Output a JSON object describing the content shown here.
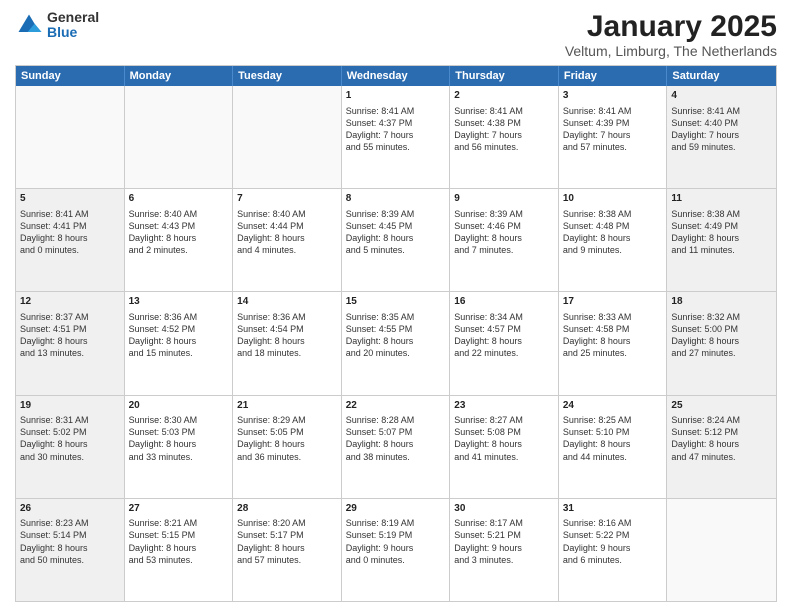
{
  "logo": {
    "general": "General",
    "blue": "Blue"
  },
  "header": {
    "month": "January 2025",
    "location": "Veltum, Limburg, The Netherlands"
  },
  "days": [
    "Sunday",
    "Monday",
    "Tuesday",
    "Wednesday",
    "Thursday",
    "Friday",
    "Saturday"
  ],
  "weeks": [
    [
      {
        "num": "",
        "text": "",
        "empty": true
      },
      {
        "num": "",
        "text": "",
        "empty": true
      },
      {
        "num": "",
        "text": "",
        "empty": true
      },
      {
        "num": "1",
        "text": "Sunrise: 8:41 AM\nSunset: 4:37 PM\nDaylight: 7 hours\nand 55 minutes."
      },
      {
        "num": "2",
        "text": "Sunrise: 8:41 AM\nSunset: 4:38 PM\nDaylight: 7 hours\nand 56 minutes."
      },
      {
        "num": "3",
        "text": "Sunrise: 8:41 AM\nSunset: 4:39 PM\nDaylight: 7 hours\nand 57 minutes."
      },
      {
        "num": "4",
        "text": "Sunrise: 8:41 AM\nSunset: 4:40 PM\nDaylight: 7 hours\nand 59 minutes."
      }
    ],
    [
      {
        "num": "5",
        "text": "Sunrise: 8:41 AM\nSunset: 4:41 PM\nDaylight: 8 hours\nand 0 minutes."
      },
      {
        "num": "6",
        "text": "Sunrise: 8:40 AM\nSunset: 4:43 PM\nDaylight: 8 hours\nand 2 minutes."
      },
      {
        "num": "7",
        "text": "Sunrise: 8:40 AM\nSunset: 4:44 PM\nDaylight: 8 hours\nand 4 minutes."
      },
      {
        "num": "8",
        "text": "Sunrise: 8:39 AM\nSunset: 4:45 PM\nDaylight: 8 hours\nand 5 minutes."
      },
      {
        "num": "9",
        "text": "Sunrise: 8:39 AM\nSunset: 4:46 PM\nDaylight: 8 hours\nand 7 minutes."
      },
      {
        "num": "10",
        "text": "Sunrise: 8:38 AM\nSunset: 4:48 PM\nDaylight: 8 hours\nand 9 minutes."
      },
      {
        "num": "11",
        "text": "Sunrise: 8:38 AM\nSunset: 4:49 PM\nDaylight: 8 hours\nand 11 minutes."
      }
    ],
    [
      {
        "num": "12",
        "text": "Sunrise: 8:37 AM\nSunset: 4:51 PM\nDaylight: 8 hours\nand 13 minutes."
      },
      {
        "num": "13",
        "text": "Sunrise: 8:36 AM\nSunset: 4:52 PM\nDaylight: 8 hours\nand 15 minutes."
      },
      {
        "num": "14",
        "text": "Sunrise: 8:36 AM\nSunset: 4:54 PM\nDaylight: 8 hours\nand 18 minutes."
      },
      {
        "num": "15",
        "text": "Sunrise: 8:35 AM\nSunset: 4:55 PM\nDaylight: 8 hours\nand 20 minutes."
      },
      {
        "num": "16",
        "text": "Sunrise: 8:34 AM\nSunset: 4:57 PM\nDaylight: 8 hours\nand 22 minutes."
      },
      {
        "num": "17",
        "text": "Sunrise: 8:33 AM\nSunset: 4:58 PM\nDaylight: 8 hours\nand 25 minutes."
      },
      {
        "num": "18",
        "text": "Sunrise: 8:32 AM\nSunset: 5:00 PM\nDaylight: 8 hours\nand 27 minutes."
      }
    ],
    [
      {
        "num": "19",
        "text": "Sunrise: 8:31 AM\nSunset: 5:02 PM\nDaylight: 8 hours\nand 30 minutes."
      },
      {
        "num": "20",
        "text": "Sunrise: 8:30 AM\nSunset: 5:03 PM\nDaylight: 8 hours\nand 33 minutes."
      },
      {
        "num": "21",
        "text": "Sunrise: 8:29 AM\nSunset: 5:05 PM\nDaylight: 8 hours\nand 36 minutes."
      },
      {
        "num": "22",
        "text": "Sunrise: 8:28 AM\nSunset: 5:07 PM\nDaylight: 8 hours\nand 38 minutes."
      },
      {
        "num": "23",
        "text": "Sunrise: 8:27 AM\nSunset: 5:08 PM\nDaylight: 8 hours\nand 41 minutes."
      },
      {
        "num": "24",
        "text": "Sunrise: 8:25 AM\nSunset: 5:10 PM\nDaylight: 8 hours\nand 44 minutes."
      },
      {
        "num": "25",
        "text": "Sunrise: 8:24 AM\nSunset: 5:12 PM\nDaylight: 8 hours\nand 47 minutes."
      }
    ],
    [
      {
        "num": "26",
        "text": "Sunrise: 8:23 AM\nSunset: 5:14 PM\nDaylight: 8 hours\nand 50 minutes."
      },
      {
        "num": "27",
        "text": "Sunrise: 8:21 AM\nSunset: 5:15 PM\nDaylight: 8 hours\nand 53 minutes."
      },
      {
        "num": "28",
        "text": "Sunrise: 8:20 AM\nSunset: 5:17 PM\nDaylight: 8 hours\nand 57 minutes."
      },
      {
        "num": "29",
        "text": "Sunrise: 8:19 AM\nSunset: 5:19 PM\nDaylight: 9 hours\nand 0 minutes."
      },
      {
        "num": "30",
        "text": "Sunrise: 8:17 AM\nSunset: 5:21 PM\nDaylight: 9 hours\nand 3 minutes."
      },
      {
        "num": "31",
        "text": "Sunrise: 8:16 AM\nSunset: 5:22 PM\nDaylight: 9 hours\nand 6 minutes."
      },
      {
        "num": "",
        "text": "",
        "empty": true
      }
    ]
  ]
}
